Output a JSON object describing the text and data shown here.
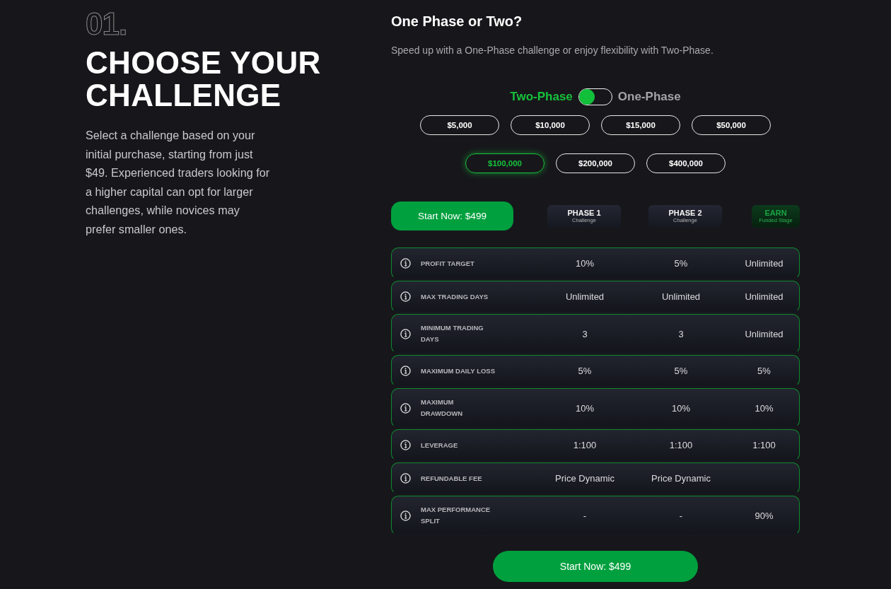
{
  "intro": {
    "number": "01.",
    "heading": "CHOOSE YOUR CHALLENGE",
    "description": "Select a challenge based on your initial purchase, starting from just $49. Experienced traders looking for a higher capital can opt for larger challenges, while novices may prefer smaller ones."
  },
  "selector": {
    "title": "One Phase or Two?",
    "subtitle": "Speed up with a One-Phase challenge or enjoy flexibility with Two-Phase.",
    "phase_options": [
      {
        "label": "Two-Phase",
        "selected": true
      },
      {
        "label": "One-Phase",
        "selected": false
      }
    ],
    "amounts": [
      {
        "label": "$5,000",
        "selected": false
      },
      {
        "label": "$10,000",
        "selected": false
      },
      {
        "label": "$15,000",
        "selected": false
      },
      {
        "label": "$50,000",
        "selected": false
      },
      {
        "label": "$100,000",
        "selected": true
      },
      {
        "label": "$200,000",
        "selected": false
      },
      {
        "label": "$400,000",
        "selected": false
      }
    ]
  },
  "comparison": {
    "start_button": "Start Now: $499",
    "columns": [
      {
        "title": "PHASE 1",
        "subtitle": "Challenge",
        "kind": "phase"
      },
      {
        "title": "PHASE 2",
        "subtitle": "Challenge",
        "kind": "phase"
      },
      {
        "title": "EARN",
        "subtitle": "Funded Stage",
        "kind": "earn"
      }
    ],
    "rows": [
      {
        "label": "PROFIT TARGET",
        "values": [
          "10%",
          "5%",
          "Unlimited"
        ]
      },
      {
        "label": "MAX TRADING DAYS",
        "values": [
          "Unlimited",
          "Unlimited",
          "Unlimited"
        ]
      },
      {
        "label": "MINIMUM TRADING\nDAYS",
        "values": [
          "3",
          "3",
          "Unlimited"
        ]
      },
      {
        "label": "MAXIMUM DAILY LOSS",
        "values": [
          "5%",
          "5%",
          "5%"
        ]
      },
      {
        "label": "MAXIMUM\nDRAWDOWN",
        "values": [
          "10%",
          "10%",
          "10%"
        ]
      },
      {
        "label": "LEVERAGE",
        "values": [
          "1:100",
          "1:100",
          "1:100"
        ]
      },
      {
        "label": "REFUNDABLE FEE",
        "values": [
          "Price Dynamic",
          "Price Dynamic"
        ]
      },
      {
        "label": "MAX PERFORMANCE\nSPLIT",
        "values": [
          "-",
          "-",
          "90%"
        ]
      }
    ]
  },
  "footer_button": "Start Now: $499"
}
